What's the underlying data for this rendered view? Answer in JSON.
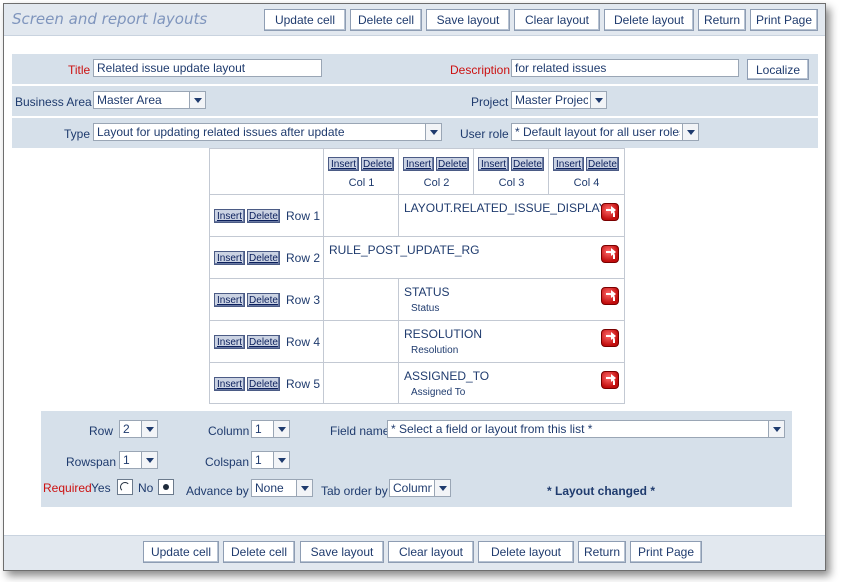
{
  "app": {
    "title": "Screen and report layouts"
  },
  "toolbar": {
    "update_cell": "Update cell",
    "delete_cell": "Delete cell",
    "save_layout": "Save layout",
    "clear_layout": "Clear layout",
    "delete_layout": "Delete layout",
    "return": "Return",
    "print_page": "Print Page"
  },
  "form": {
    "title_label": "Title",
    "title_value": "Related issue update layout",
    "description_label": "Description",
    "description_value": "for related issues",
    "localize_button": "Localize",
    "business_area_label": "Business Area",
    "business_area_value": "Master Area",
    "project_label": "Project",
    "project_value": "Master Project",
    "type_label": "Type",
    "type_value": "Layout for updating related issues after update",
    "user_role_label": "User role",
    "user_role_value": "* Default layout for all user roles *"
  },
  "grid": {
    "insert_label": "Insert",
    "delete_label": "Delete",
    "columns": [
      "Col 1",
      "Col 2",
      "Col 3",
      "Col 4"
    ],
    "rows": [
      {
        "label": "Row 1",
        "fields": [
          {
            "name": "LAYOUT.RELATED_ISSUE_DISPLAY",
            "sub": ""
          }
        ]
      },
      {
        "label": "Row 2",
        "fields": [
          {
            "name": "RULE_POST_UPDATE_RG",
            "sub": ""
          }
        ]
      },
      {
        "label": "Row 3",
        "fields": [
          {
            "name": "STATUS",
            "sub": "Status"
          }
        ]
      },
      {
        "label": "Row 4",
        "fields": [
          {
            "name": "RESOLUTION",
            "sub": "Resolution"
          }
        ]
      },
      {
        "label": "Row 5",
        "fields": [
          {
            "name": "ASSIGNED_TO",
            "sub": "Assigned To"
          }
        ]
      }
    ]
  },
  "cell_editor": {
    "row_label": "Row",
    "row_value": "2",
    "column_label": "Column",
    "column_value": "1",
    "field_name_label": "Field name",
    "field_name_value": "* Select a field or layout from this list *",
    "rowspan_label": "Rowspan",
    "rowspan_value": "1",
    "colspan_label": "Colspan",
    "colspan_value": "1",
    "required_label": "Required",
    "yes_label": "Yes",
    "no_label": "No",
    "required_selected": "No",
    "advance_by_label": "Advance by",
    "advance_by_value": "None",
    "tab_order_label": "Tab order by",
    "tab_order_value": "Column",
    "status_text": "* Layout changed *"
  },
  "icons": {
    "edit": "edit-cell-icon",
    "dropdown": "chevron-down-icon"
  },
  "colors": {
    "panel_bg": "#d6e0ea",
    "title_color": "#7f95bd",
    "required_color": "#cc1111",
    "edit_icon": "#c10d0d"
  }
}
